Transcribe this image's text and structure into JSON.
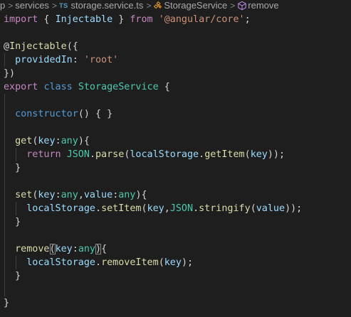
{
  "breadcrumb": {
    "items": [
      "p",
      "services",
      "storage.service.ts",
      "StorageService",
      "remove"
    ],
    "file_badge": "TS",
    "separator": ">"
  },
  "colors": {
    "background": "#1e1e1e",
    "keyword_blue": "#569cd6",
    "keyword_purple": "#c586c0",
    "string": "#ce9178",
    "identifier": "#9cdcfe",
    "type": "#4ec9b0",
    "function": "#dcdcaa",
    "text": "#d4d4d4"
  },
  "icons": {
    "file": "typescript-file-icon",
    "class": "class-symbol-icon",
    "method": "method-symbol-icon"
  },
  "code": {
    "l1": {
      "import": "import",
      "ob": " { ",
      "name": "Injectable",
      "cb": " } ",
      "from": "from",
      "sp": " ",
      "path": "'@angular/core'",
      "semi": ";"
    },
    "l3": {
      "at": "@",
      "name": "Injectable",
      "rest": "({"
    },
    "l4": {
      "key": "providedIn",
      "colon": ": ",
      "val": "'root'"
    },
    "l5": {
      "text": "})"
    },
    "l6": {
      "export": "export",
      "sp1": " ",
      "class": "class",
      "sp2": " ",
      "name": "StorageService",
      "ob": " {"
    },
    "l8": {
      "fn": "constructor",
      "rest": "() { }"
    },
    "l10": {
      "fn": "get",
      "op": "(",
      "key": "key",
      "colon": ":",
      "type": "any",
      "cp": "){"
    },
    "l11": {
      "ret": "return",
      "sp": " ",
      "json": "JSON",
      "dot1": ".",
      "parse": "parse",
      "op1": "(",
      "ls": "localStorage",
      "dot2": ".",
      "getItem": "getItem",
      "op2": "(",
      "key": "key",
      "end": "));"
    },
    "l12": {
      "text": "}"
    },
    "l14": {
      "fn": "set",
      "op": "(",
      "key": "key",
      "colon1": ":",
      "type1": "any",
      "comma": ",",
      "value": "value",
      "colon2": ":",
      "type2": "any",
      "cp": "){"
    },
    "l15": {
      "ls": "localStorage",
      "dot1": ".",
      "setItem": "setItem",
      "op1": "(",
      "key": "key",
      "comma": ",",
      "json": "JSON",
      "dot2": ".",
      "stringify": "stringify",
      "op2": "(",
      "value": "value",
      "end": "));"
    },
    "l16": {
      "text": "}"
    },
    "l18": {
      "fn": "remove",
      "op": "(",
      "key": "key",
      "colon": ":",
      "type": "any",
      "cp": ")",
      "ob": "{"
    },
    "l19": {
      "ls": "localStorage",
      "dot": ".",
      "removeItem": "removeItem",
      "op": "(",
      "key": "key",
      "end": ");"
    },
    "l20": {
      "text": "}"
    },
    "l22": {
      "text": "}"
    }
  }
}
